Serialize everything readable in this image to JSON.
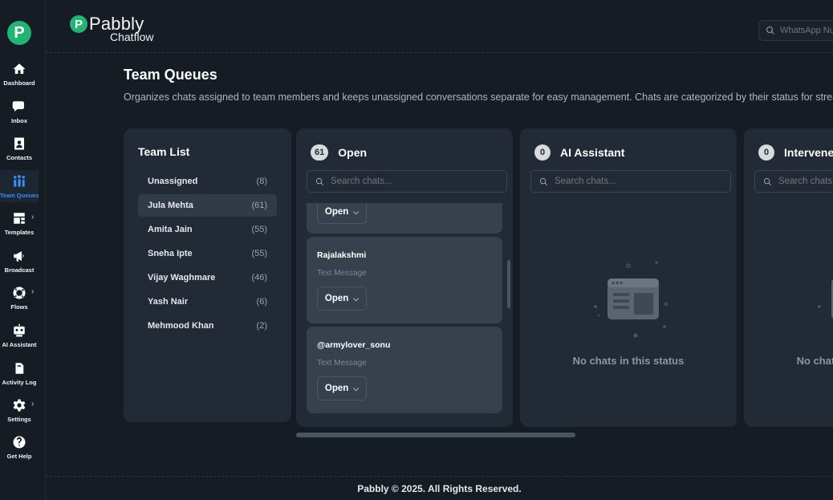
{
  "brand": {
    "mark": "P",
    "name": "Pabbly",
    "sub": "Chatflow"
  },
  "top_search": {
    "placeholder": "WhatsApp Number"
  },
  "sidebar": {
    "logo": "P",
    "items": [
      {
        "label": "Dashboard",
        "icon": "home-icon"
      },
      {
        "label": "Inbox",
        "icon": "chat-icon"
      },
      {
        "label": "Contacts",
        "icon": "contacts-icon"
      },
      {
        "label": "Team Queues",
        "icon": "team-icon",
        "active": true
      },
      {
        "label": "Templates",
        "icon": "templates-icon",
        "expandable": true
      },
      {
        "label": "Broadcast",
        "icon": "megaphone-icon"
      },
      {
        "label": "Flows",
        "icon": "flows-icon",
        "expandable": true
      },
      {
        "label": "AI Assistant",
        "icon": "robot-icon"
      },
      {
        "label": "Activity Log",
        "icon": "activity-icon"
      },
      {
        "label": "Settings",
        "icon": "gear-icon",
        "expandable": true
      },
      {
        "label": "Get Help",
        "icon": "help-icon"
      }
    ]
  },
  "page": {
    "title": "Team Queues",
    "description": "Organizes chats assigned to team members and keeps unassigned conversations separate for easy management. Chats are categorized by their status for streamlined handling."
  },
  "team_list": {
    "title": "Team List",
    "members": [
      {
        "name": "Unassigned",
        "count": "(8)"
      },
      {
        "name": "Jula Mehta",
        "count": "(61)",
        "active": true
      },
      {
        "name": "Amita Jain",
        "count": "(55)"
      },
      {
        "name": "Sneha Ipte",
        "count": "(55)"
      },
      {
        "name": "Vijay Waghmare",
        "count": "(46)"
      },
      {
        "name": "Yash Nair",
        "count": "(6)"
      },
      {
        "name": "Mehmood Khan",
        "count": "(2)"
      }
    ]
  },
  "columns": [
    {
      "title": "Open",
      "count": "61",
      "search_placeholder": "Search chats..."
    },
    {
      "title": "AI Assistant",
      "count": "0",
      "search_placeholder": "Search chats...",
      "empty_text": "No chats in this status"
    },
    {
      "title": "Intervened",
      "count": "0",
      "search_placeholder": "Search chats...",
      "empty_text": "No chats in this status"
    }
  ],
  "chats": [
    {
      "name": "",
      "type": "",
      "button": "Open"
    },
    {
      "name": "Rajalakshmi",
      "type": "Text Message",
      "button": "Open"
    },
    {
      "name": "@armylover_sonu",
      "type": "Text Message",
      "button": "Open"
    }
  ],
  "footer": {
    "text": "Pabbly © 2025. All Rights Reserved."
  },
  "colors": {
    "accent": "#3b8ef3",
    "brand": "#21b573",
    "background": "#161c24",
    "card": "#222a35"
  }
}
